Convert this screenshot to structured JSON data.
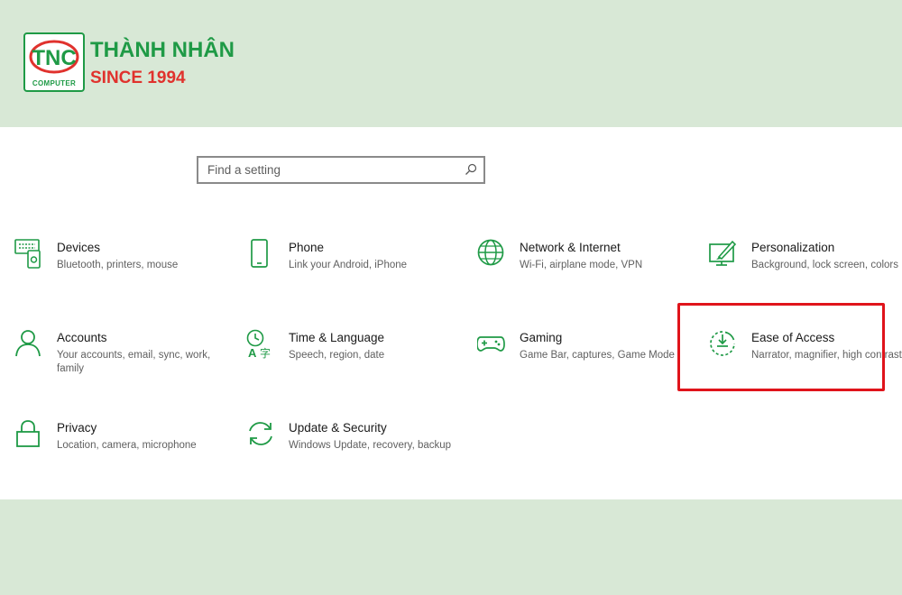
{
  "brand": {
    "logo_text": "TNC",
    "logo_sub": "COMPUTER",
    "name": "THÀNH NHÂN",
    "since": "SINCE 1994"
  },
  "search": {
    "placeholder": "Find a setting",
    "icon": "search-icon"
  },
  "accent_color": "#1f9a46",
  "highlight_color": "#e0141b",
  "tiles": [
    {
      "icon": "devices-icon",
      "title": "Devices",
      "desc": "Bluetooth, printers, mouse"
    },
    {
      "icon": "phone-icon",
      "title": "Phone",
      "desc": "Link your Android, iPhone"
    },
    {
      "icon": "globe-icon",
      "title": "Network & Internet",
      "desc": "Wi-Fi, airplane mode, VPN"
    },
    {
      "icon": "personalization-icon",
      "title": "Personalization",
      "desc": "Background, lock screen, colors"
    },
    {
      "icon": "person-icon",
      "title": "Accounts",
      "desc": "Your accounts, email, sync, work, family"
    },
    {
      "icon": "time-language-icon",
      "title": "Time & Language",
      "desc": "Speech, region, date"
    },
    {
      "icon": "gamepad-icon",
      "title": "Gaming",
      "desc": "Game Bar, captures, Game Mode"
    },
    {
      "icon": "ease-of-access-icon",
      "title": "Ease of Access",
      "desc": "Narrator, magnifier, high contrast"
    },
    {
      "icon": "lock-icon",
      "title": "Privacy",
      "desc": "Location, camera, microphone"
    },
    {
      "icon": "sync-icon",
      "title": "Update & Security",
      "desc": "Windows Update, recovery, backup"
    }
  ]
}
